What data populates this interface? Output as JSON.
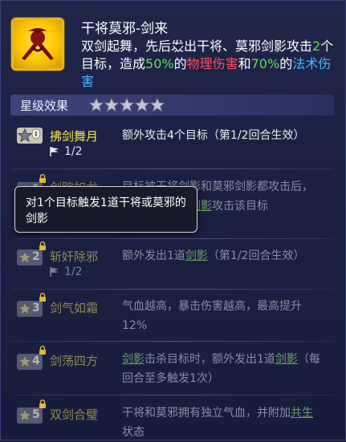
{
  "skill": {
    "icon": "swords-icon",
    "title": "干将莫邪-剑来",
    "desc_parts": {
      "p1": "双剑起舞，先后发出干将、莫邪剑影攻击",
      "count": "2",
      "p2": "个目标，造成",
      "pct_phys": "50%",
      "p3": "的",
      "phys": "物理伤害",
      "p4": "和",
      "pct_magic": "70%",
      "p5": "的",
      "magic": "法术伤害"
    }
  },
  "star_effects": {
    "label": "星级效果",
    "stars_icon": "star-icon",
    "star_count": 5
  },
  "effects": [
    {
      "star": "0",
      "name": "拂剑舞月",
      "progress": "1/2",
      "state": "active",
      "desc": "额外攻击4个目标（第1/2回合生效）"
    },
    {
      "star": "1",
      "name": "剑踪如龙",
      "state": "locked",
      "desc_a": "目标被干将剑影和莫邪剑影都攻击",
      "desc_b": "后，额外发出一道",
      "desc_link": "剑影",
      "desc_c": "攻击该目标"
    },
    {
      "star": "2",
      "name": "斩奸除邪",
      "progress": "1/2",
      "state": "locked",
      "desc_a": "额外发出1道",
      "desc_link": "剑影",
      "desc_b": "（第1/2回合生效）"
    },
    {
      "star": "3",
      "name": "剑气如霜",
      "state": "locked",
      "desc": "气血越高，暴击伤害越高，最高提升12%"
    },
    {
      "star": "4",
      "name": "剑荡四方",
      "state": "locked",
      "desc_link1": "剑影",
      "desc_a": "击杀目标时，额外发出1道",
      "desc_link2": "剑影",
      "desc_b": "（每回合至多触发1次）"
    },
    {
      "star": "5",
      "name": "双剑合璧",
      "state": "locked",
      "desc_a": "干将和莫邪拥有独立气血，并附加",
      "desc_link": "共生",
      "desc_b": "状态"
    }
  ],
  "tooltip": {
    "text": "对1个目标触发1道干将或莫邪的剑影"
  },
  "colors": {
    "gold": "#f6e35a",
    "green": "#5fe14a",
    "red": "#ff4d5e",
    "blue": "#49b7ff"
  }
}
